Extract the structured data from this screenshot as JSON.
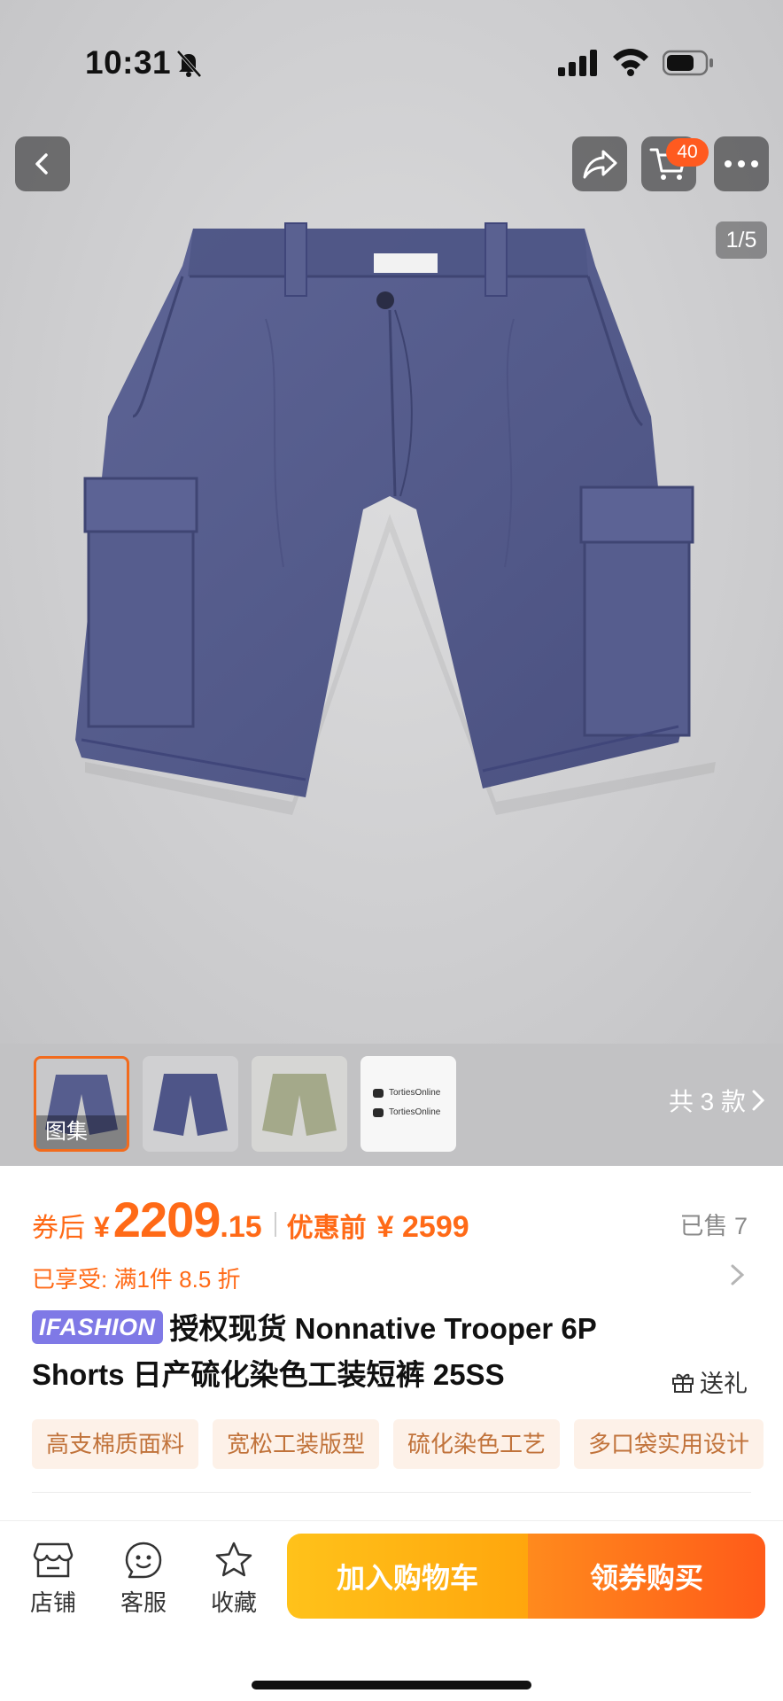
{
  "status_bar": {
    "time": "10:31"
  },
  "nav": {
    "cart_count": "40",
    "image_counter": "1/5"
  },
  "gallery": {
    "thumb_label": "图集",
    "watermark_lines": [
      "TortiesOnline",
      "TortiesOnline"
    ],
    "variants_label": "共 3 款"
  },
  "price": {
    "after_coupon_label": "券后",
    "currency": "¥",
    "int": "2209",
    "dec": ".15",
    "original_label": "优惠前",
    "original_price": "¥ 2599",
    "sold": "已售 7"
  },
  "promotion": "已享受: 满1件 8.5 折",
  "product": {
    "brand_tag": "IFASHION",
    "title": "授权现货 Nonnative Trooper 6P Shorts 日产硫化染色工装短裤 25SS",
    "gift_label": "送礼"
  },
  "tags": [
    "高支棉质面料",
    "宽松工装版型",
    "硫化染色工艺",
    "多口袋实用设计"
  ],
  "bottom_bar": {
    "store": "店铺",
    "service": "客服",
    "favorite": "收藏",
    "add_to_cart": "加入购物车",
    "buy_with_coupon": "领券购买"
  },
  "colors": {
    "accent": "#ff6a17",
    "brand_tag": "#7f79e6",
    "cart_btn": "#ffb414",
    "buy_btn": "#ff6a1a"
  }
}
